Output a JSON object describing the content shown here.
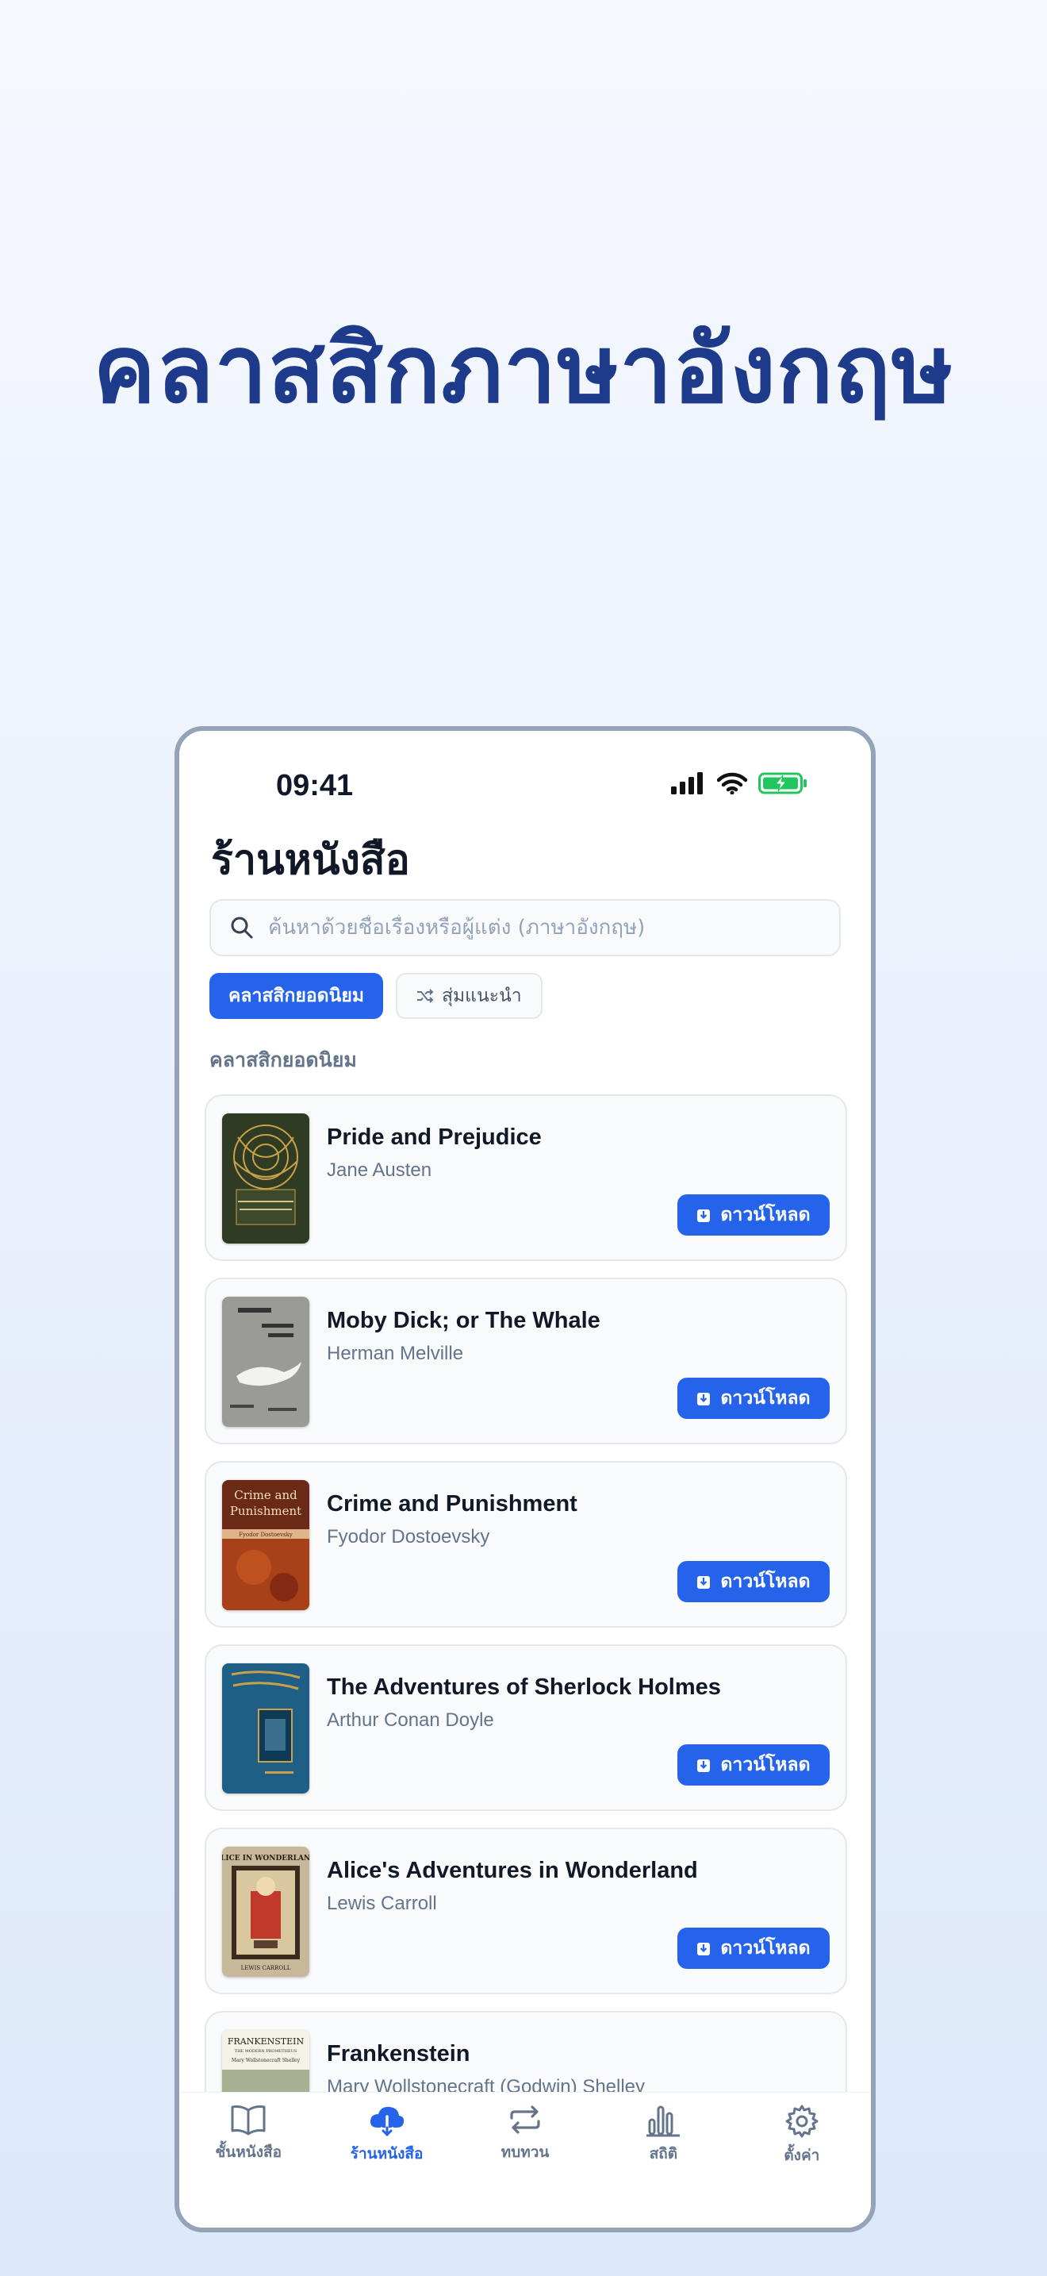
{
  "headline": "คลาสสิกภาษาอังกฤษ",
  "status_bar": {
    "time": "09:41"
  },
  "page_title": "ร้านหนังสือ",
  "search": {
    "placeholder": "ค้นหาด้วยชื่อเรื่องหรือผู้แต่ง (ภาษาอังกฤษ)"
  },
  "chips": {
    "popular": "คลาสสิกยอดนิยม",
    "random": "สุ่มแนะนำ"
  },
  "section_label": "คลาสสิกยอดนิยม",
  "download_label": "ดาวน์โหลด",
  "books": [
    {
      "title": "Pride and Prejudice",
      "author": "Jane Austen"
    },
    {
      "title": "Moby Dick; or The Whale",
      "author": "Herman Melville"
    },
    {
      "title": "Crime and Punishment",
      "author": "Fyodor Dostoevsky"
    },
    {
      "title": "The Adventures of Sherlock Holmes",
      "author": "Arthur Conan Doyle"
    },
    {
      "title": "Alice's Adventures in Wonderland",
      "author": "Lewis Carroll"
    },
    {
      "title": "Frankenstein",
      "author": "Mary Wollstonecraft (Godwin) Shelley"
    }
  ],
  "covers": {
    "crime": [
      "Crime and",
      "Punishment",
      "Fyodor Dostoevsky"
    ],
    "alice": [
      "ALICE IN WONDERLAND",
      "LEWIS CARROLL"
    ],
    "frankenstein": [
      "FRANKENSTEIN",
      "THE MODERN PROMETHEUS",
      "Mary Wollstonecraft Shelley"
    ]
  },
  "tabs": [
    {
      "label": "ชั้นหนังสือ",
      "icon": "book-open-icon"
    },
    {
      "label": "ร้านหนังสือ",
      "icon": "cloud-download-icon"
    },
    {
      "label": "ทบทวน",
      "icon": "repeat-icon"
    },
    {
      "label": "สถิติ",
      "icon": "bar-chart-icon"
    },
    {
      "label": "ตั้งค่า",
      "icon": "gear-icon"
    }
  ],
  "colors": {
    "accent": "#2563eb",
    "headline": "#1e3a8a",
    "battery": "#22c55e"
  }
}
